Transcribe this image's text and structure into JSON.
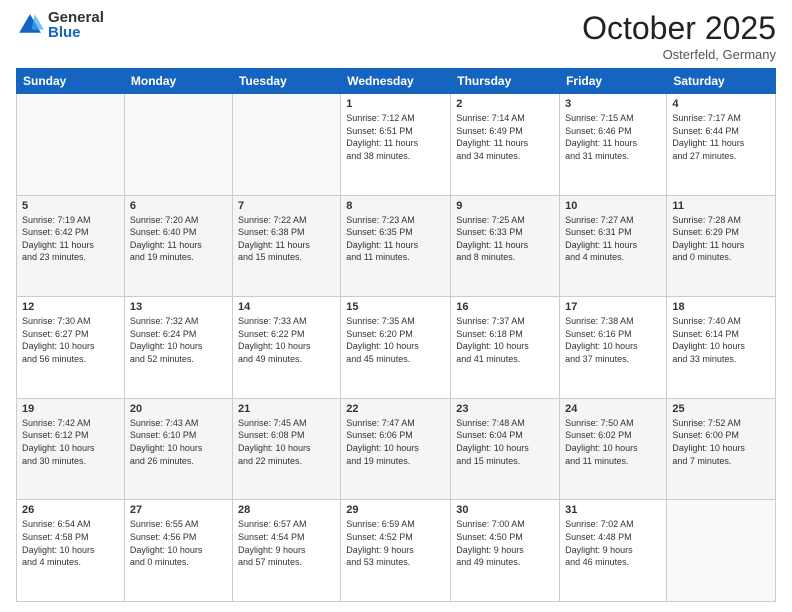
{
  "logo": {
    "general": "General",
    "blue": "Blue"
  },
  "header": {
    "month": "October 2025",
    "location": "Osterfeld, Germany"
  },
  "days_of_week": [
    "Sunday",
    "Monday",
    "Tuesday",
    "Wednesday",
    "Thursday",
    "Friday",
    "Saturday"
  ],
  "weeks": [
    [
      {
        "day": "",
        "info": ""
      },
      {
        "day": "",
        "info": ""
      },
      {
        "day": "",
        "info": ""
      },
      {
        "day": "1",
        "info": "Sunrise: 7:12 AM\nSunset: 6:51 PM\nDaylight: 11 hours\nand 38 minutes."
      },
      {
        "day": "2",
        "info": "Sunrise: 7:14 AM\nSunset: 6:49 PM\nDaylight: 11 hours\nand 34 minutes."
      },
      {
        "day": "3",
        "info": "Sunrise: 7:15 AM\nSunset: 6:46 PM\nDaylight: 11 hours\nand 31 minutes."
      },
      {
        "day": "4",
        "info": "Sunrise: 7:17 AM\nSunset: 6:44 PM\nDaylight: 11 hours\nand 27 minutes."
      }
    ],
    [
      {
        "day": "5",
        "info": "Sunrise: 7:19 AM\nSunset: 6:42 PM\nDaylight: 11 hours\nand 23 minutes."
      },
      {
        "day": "6",
        "info": "Sunrise: 7:20 AM\nSunset: 6:40 PM\nDaylight: 11 hours\nand 19 minutes."
      },
      {
        "day": "7",
        "info": "Sunrise: 7:22 AM\nSunset: 6:38 PM\nDaylight: 11 hours\nand 15 minutes."
      },
      {
        "day": "8",
        "info": "Sunrise: 7:23 AM\nSunset: 6:35 PM\nDaylight: 11 hours\nand 11 minutes."
      },
      {
        "day": "9",
        "info": "Sunrise: 7:25 AM\nSunset: 6:33 PM\nDaylight: 11 hours\nand 8 minutes."
      },
      {
        "day": "10",
        "info": "Sunrise: 7:27 AM\nSunset: 6:31 PM\nDaylight: 11 hours\nand 4 minutes."
      },
      {
        "day": "11",
        "info": "Sunrise: 7:28 AM\nSunset: 6:29 PM\nDaylight: 11 hours\nand 0 minutes."
      }
    ],
    [
      {
        "day": "12",
        "info": "Sunrise: 7:30 AM\nSunset: 6:27 PM\nDaylight: 10 hours\nand 56 minutes."
      },
      {
        "day": "13",
        "info": "Sunrise: 7:32 AM\nSunset: 6:24 PM\nDaylight: 10 hours\nand 52 minutes."
      },
      {
        "day": "14",
        "info": "Sunrise: 7:33 AM\nSunset: 6:22 PM\nDaylight: 10 hours\nand 49 minutes."
      },
      {
        "day": "15",
        "info": "Sunrise: 7:35 AM\nSunset: 6:20 PM\nDaylight: 10 hours\nand 45 minutes."
      },
      {
        "day": "16",
        "info": "Sunrise: 7:37 AM\nSunset: 6:18 PM\nDaylight: 10 hours\nand 41 minutes."
      },
      {
        "day": "17",
        "info": "Sunrise: 7:38 AM\nSunset: 6:16 PM\nDaylight: 10 hours\nand 37 minutes."
      },
      {
        "day": "18",
        "info": "Sunrise: 7:40 AM\nSunset: 6:14 PM\nDaylight: 10 hours\nand 33 minutes."
      }
    ],
    [
      {
        "day": "19",
        "info": "Sunrise: 7:42 AM\nSunset: 6:12 PM\nDaylight: 10 hours\nand 30 minutes."
      },
      {
        "day": "20",
        "info": "Sunrise: 7:43 AM\nSunset: 6:10 PM\nDaylight: 10 hours\nand 26 minutes."
      },
      {
        "day": "21",
        "info": "Sunrise: 7:45 AM\nSunset: 6:08 PM\nDaylight: 10 hours\nand 22 minutes."
      },
      {
        "day": "22",
        "info": "Sunrise: 7:47 AM\nSunset: 6:06 PM\nDaylight: 10 hours\nand 19 minutes."
      },
      {
        "day": "23",
        "info": "Sunrise: 7:48 AM\nSunset: 6:04 PM\nDaylight: 10 hours\nand 15 minutes."
      },
      {
        "day": "24",
        "info": "Sunrise: 7:50 AM\nSunset: 6:02 PM\nDaylight: 10 hours\nand 11 minutes."
      },
      {
        "day": "25",
        "info": "Sunrise: 7:52 AM\nSunset: 6:00 PM\nDaylight: 10 hours\nand 7 minutes."
      }
    ],
    [
      {
        "day": "26",
        "info": "Sunrise: 6:54 AM\nSunset: 4:58 PM\nDaylight: 10 hours\nand 4 minutes."
      },
      {
        "day": "27",
        "info": "Sunrise: 6:55 AM\nSunset: 4:56 PM\nDaylight: 10 hours\nand 0 minutes."
      },
      {
        "day": "28",
        "info": "Sunrise: 6:57 AM\nSunset: 4:54 PM\nDaylight: 9 hours\nand 57 minutes."
      },
      {
        "day": "29",
        "info": "Sunrise: 6:59 AM\nSunset: 4:52 PM\nDaylight: 9 hours\nand 53 minutes."
      },
      {
        "day": "30",
        "info": "Sunrise: 7:00 AM\nSunset: 4:50 PM\nDaylight: 9 hours\nand 49 minutes."
      },
      {
        "day": "31",
        "info": "Sunrise: 7:02 AM\nSunset: 4:48 PM\nDaylight: 9 hours\nand 46 minutes."
      },
      {
        "day": "",
        "info": ""
      }
    ]
  ]
}
